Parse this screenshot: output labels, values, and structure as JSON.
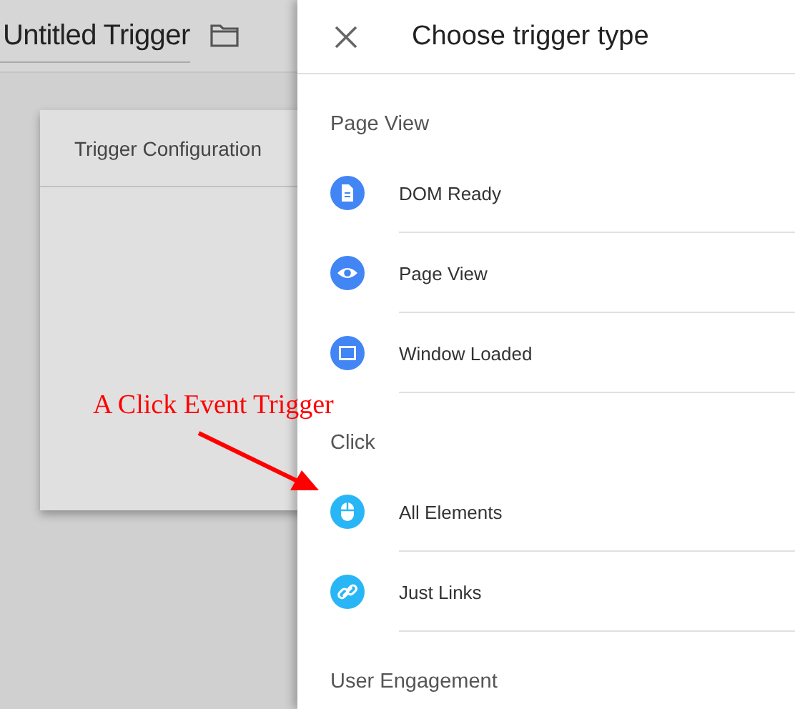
{
  "trigger_title": "Untitled Trigger",
  "card": {
    "title": "Trigger Configuration"
  },
  "panel": {
    "title": "Choose trigger type",
    "sections": [
      {
        "label": "Page View",
        "items": [
          {
            "label": "DOM Ready",
            "kind": "document",
            "color": "#4285f4"
          },
          {
            "label": "Page View",
            "kind": "eye",
            "color": "#4285f4"
          },
          {
            "label": "Window Loaded",
            "kind": "window",
            "color": "#4285f4"
          }
        ]
      },
      {
        "label": "Click",
        "items": [
          {
            "label": "All Elements",
            "kind": "mouse",
            "color": "#29b6f6"
          },
          {
            "label": "Just Links",
            "kind": "link",
            "color": "#29b6f6"
          }
        ]
      },
      {
        "label": "User Engagement"
      }
    ]
  },
  "annotation": {
    "text": "A Click Event Trigger"
  }
}
